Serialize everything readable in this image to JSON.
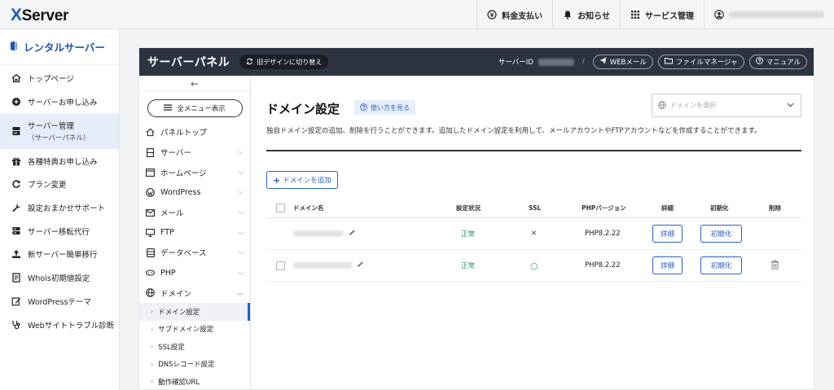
{
  "brand": {
    "name": "XServer"
  },
  "topnav": {
    "billing": "料金支払い",
    "notice": "お知らせ",
    "services": "サービス管理"
  },
  "leftnav": {
    "title": "レンタルサーバー",
    "items": [
      {
        "label": "トップページ",
        "icon": "home-icon"
      },
      {
        "label": "サーバーお申し込み",
        "icon": "plus-circle-icon"
      },
      {
        "label": "サーバー管理",
        "sub": "（サーバーパネル）",
        "icon": "server-icon"
      },
      {
        "label": "各種特典お申し込み",
        "icon": "gift-icon"
      },
      {
        "label": "プラン変更",
        "icon": "refresh-icon"
      },
      {
        "label": "設定おまかせサポート",
        "icon": "wrench-icon"
      },
      {
        "label": "サーバー移転代行",
        "icon": "server-move-icon"
      },
      {
        "label": "新サーバー簡単移行",
        "icon": "upload-icon"
      },
      {
        "label": "Whois初期値設定",
        "icon": "document-icon"
      },
      {
        "label": "WordPressテーマ",
        "icon": "edit-icon"
      },
      {
        "label": "Webサイトトラブル診断",
        "icon": "stethoscope-icon"
      }
    ]
  },
  "panel": {
    "title": "サーバーパネル",
    "old_design": "旧デザインに切り替え",
    "server_id_label": "サーバーID",
    "separator": "/",
    "webmail": "WEBメール",
    "file_manager": "ファイルマネージャ",
    "manual": "マニュアル"
  },
  "menu": {
    "back_arrow": "←",
    "all_menu": "全メニュー表示",
    "items": [
      {
        "label": "パネルトップ",
        "icon": "home-icon",
        "chevron": ""
      },
      {
        "label": "サーバー",
        "icon": "server-icon",
        "chevron": "⌵"
      },
      {
        "label": "ホームページ",
        "icon": "browser-icon",
        "chevron": "⌵"
      },
      {
        "label": "WordPress",
        "icon": "wordpress-icon",
        "chevron": "⌵"
      },
      {
        "label": "メール",
        "icon": "mail-icon",
        "chevron": "⌵"
      },
      {
        "label": "FTP",
        "icon": "monitor-icon",
        "chevron": "⌵"
      },
      {
        "label": "データベース",
        "icon": "database-icon",
        "chevron": "⌵"
      },
      {
        "label": "PHP",
        "icon": "php-icon",
        "chevron": "⌵"
      },
      {
        "label": "ドメイン",
        "icon": "globe-icon",
        "chevron": "︿"
      }
    ],
    "sub_items": [
      {
        "label": "ドメイン設定"
      },
      {
        "label": "サブドメイン設定"
      },
      {
        "label": "SSL設定"
      },
      {
        "label": "DNSレコード設定"
      },
      {
        "label": "動作確認URL"
      }
    ]
  },
  "content": {
    "title": "ドメイン設定",
    "help": "使い方を見る",
    "domain_select_placeholder": "ドメインを選択",
    "description": "独自ドメイン設定の追加、削除を行うことができます。追加したドメイン設定を利用して、メールアカウントやFTPアカウントなどを作成することができます。",
    "add_button": "ドメインを追加",
    "table": {
      "headers": {
        "domain": "ドメイン名",
        "status": "設定状況",
        "ssl": "SSL",
        "php": "PHPバージョン",
        "detail": "詳細",
        "reset": "初期化",
        "delete": "削除"
      },
      "rows": [
        {
          "status": "正常",
          "ssl": "✕",
          "php": "PHP8.2.22",
          "detail": "詳細",
          "reset": "初期化"
        },
        {
          "status": "正常",
          "ssl": "○",
          "php": "PHP8.2.22",
          "detail": "詳細",
          "reset": "初期化"
        }
      ]
    }
  },
  "colors": {
    "accent": "#1f5fd1",
    "header_dark": "#2c3440",
    "ok_green": "#2a9a6a"
  }
}
